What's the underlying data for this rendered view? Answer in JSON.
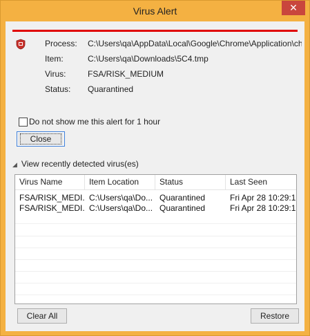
{
  "window": {
    "title": "Virus Alert",
    "close_glyph": "✕"
  },
  "details": {
    "process_label": "Process:",
    "process_value": "C:\\Users\\qa\\AppData\\Local\\Google\\Chrome\\Application\\chrome.e",
    "item_label": "Item:",
    "item_value": "C:\\Users\\qa\\Downloads\\5C4.tmp",
    "virus_label": "Virus:",
    "virus_value": "FSA/RISK_MEDIUM",
    "status_label": "Status:",
    "status_value": "Quarantined"
  },
  "options": {
    "dont_show_label": "Do not show me this alert for 1 hour",
    "dont_show_checked": false
  },
  "buttons": {
    "close_label": "Close",
    "clear_all_label": "Clear All",
    "restore_label": "Restore"
  },
  "history": {
    "toggle_label": "View recently detected virus(es)",
    "columns": [
      "Virus Name",
      "Item Location",
      "Status",
      "Last Seen"
    ],
    "rows": [
      [
        "FSA/RISK_MEDI...",
        "C:\\Users\\qa\\Do...",
        "Quarantined",
        "Fri Apr 28 10:29:1..."
      ],
      [
        "FSA/RISK_MEDI...",
        "C:\\Users\\qa\\Do...",
        "Quarantined",
        "Fri Apr 28 10:29:1..."
      ]
    ]
  },
  "colors": {
    "title_bar": "#f4b142",
    "close_button": "#c9463d",
    "alert_line": "#e00000"
  },
  "icons": {
    "app_icon": "shield-icon",
    "toggle_icon": "collapse-arrow-icon"
  }
}
